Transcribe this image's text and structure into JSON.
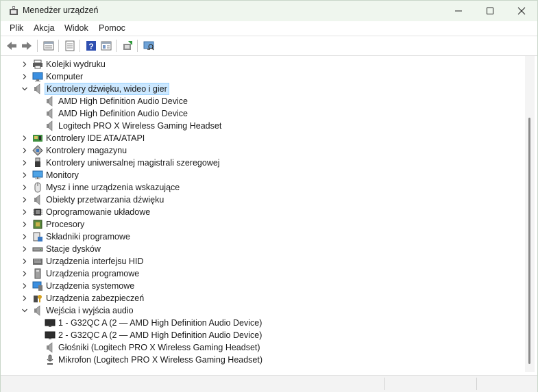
{
  "window": {
    "title": "Menedżer urządzeń",
    "buttons": {
      "minimize": "—",
      "maximize": "☐",
      "close": "✕"
    }
  },
  "menubar": {
    "items": [
      "Plik",
      "Akcja",
      "Widok",
      "Pomoc"
    ]
  },
  "toolbar": {
    "icons": [
      "back-icon",
      "forward-icon",
      "properties-list-icon",
      "document-icon",
      "help-icon",
      "view-icon",
      "update-driver-icon",
      "scan-hardware-icon"
    ]
  },
  "tree": {
    "rows": [
      {
        "label": "Kolejki wydruku",
        "level": 0,
        "expanded": false,
        "icon": "printer-icon"
      },
      {
        "label": "Komputer",
        "level": 0,
        "expanded": false,
        "icon": "computer-icon"
      },
      {
        "label": "Kontrolery dźwięku, wideo i gier",
        "level": 0,
        "expanded": true,
        "selected": true,
        "icon": "speaker-icon"
      },
      {
        "label": "AMD High Definition Audio Device",
        "level": 1,
        "icon": "speaker-icon"
      },
      {
        "label": "AMD High Definition Audio Device",
        "level": 1,
        "icon": "speaker-icon"
      },
      {
        "label": "Logitech PRO X Wireless Gaming Headset",
        "level": 1,
        "icon": "speaker-icon"
      },
      {
        "label": "Kontrolery IDE ATA/ATAPI",
        "level": 0,
        "expanded": false,
        "icon": "ide-icon"
      },
      {
        "label": "Kontrolery magazynu",
        "level": 0,
        "expanded": false,
        "icon": "storage-controller-icon"
      },
      {
        "label": "Kontrolery uniwersalnej magistrali szeregowej",
        "level": 0,
        "expanded": false,
        "icon": "usb-icon"
      },
      {
        "label": "Monitory",
        "level": 0,
        "expanded": false,
        "icon": "monitor-icon"
      },
      {
        "label": "Mysz i inne urządzenia wskazujące",
        "level": 0,
        "expanded": false,
        "icon": "mouse-icon"
      },
      {
        "label": "Obiekty przetwarzania dźwięku",
        "level": 0,
        "expanded": false,
        "icon": "speaker-icon"
      },
      {
        "label": "Oprogramowanie układowe",
        "level": 0,
        "expanded": false,
        "icon": "chip-icon"
      },
      {
        "label": "Procesory",
        "level": 0,
        "expanded": false,
        "icon": "processor-icon"
      },
      {
        "label": "Składniki programowe",
        "level": 0,
        "expanded": false,
        "icon": "software-component-icon"
      },
      {
        "label": "Stacje dysków",
        "level": 0,
        "expanded": false,
        "icon": "disk-drive-icon"
      },
      {
        "label": "Urządzenia interfejsu HID",
        "level": 0,
        "expanded": false,
        "icon": "hid-icon"
      },
      {
        "label": "Urządzenia programowe",
        "level": 0,
        "expanded": false,
        "icon": "software-device-icon"
      },
      {
        "label": "Urządzenia systemowe",
        "level": 0,
        "expanded": false,
        "icon": "system-device-icon"
      },
      {
        "label": "Urządzenia zabezpieczeń",
        "level": 0,
        "expanded": false,
        "icon": "security-device-icon"
      },
      {
        "label": "Wejścia i wyjścia audio",
        "level": 0,
        "expanded": true,
        "icon": "speaker-icon"
      },
      {
        "label": "1 - G32QC A (2 — AMD High Definition Audio Device)",
        "level": 1,
        "icon": "display-audio-icon"
      },
      {
        "label": "2 - G32QC A (2 — AMD High Definition Audio Device)",
        "level": 1,
        "icon": "display-audio-icon"
      },
      {
        "label": "Głośniki (Logitech PRO X Wireless Gaming Headset)",
        "level": 1,
        "icon": "speaker-icon"
      },
      {
        "label": "Mikrofon (Logitech PRO X Wireless Gaming Headset)",
        "level": 1,
        "icon": "microphone-icon"
      }
    ]
  },
  "colors": {
    "titlebar": "#eff6ee",
    "selection": "#cce8ff",
    "selection_border": "#99d1ff"
  }
}
